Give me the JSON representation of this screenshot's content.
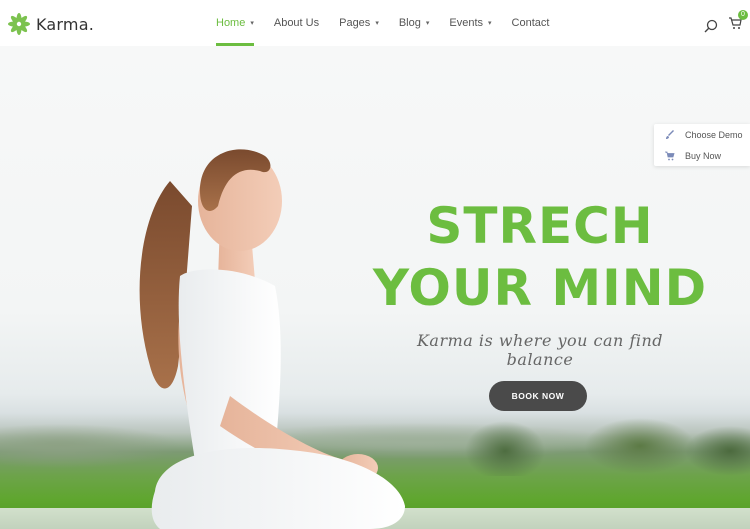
{
  "brand": {
    "name": "Karma.",
    "accent": "#6cbd40",
    "dark": "#4a4a4a"
  },
  "nav": {
    "items": [
      {
        "label": "Home",
        "has_dropdown": true,
        "active": true
      },
      {
        "label": "About Us",
        "has_dropdown": false,
        "active": false
      },
      {
        "label": "Pages",
        "has_dropdown": true,
        "active": false
      },
      {
        "label": "Blog",
        "has_dropdown": true,
        "active": false
      },
      {
        "label": "Events",
        "has_dropdown": true,
        "active": false
      },
      {
        "label": "Contact",
        "has_dropdown": false,
        "active": false
      }
    ],
    "caret": "▾"
  },
  "header_icons": {
    "search": "search-icon",
    "cart": "cart-icon",
    "cart_count": "0"
  },
  "side_panel": {
    "items": [
      {
        "label": "Choose Demo",
        "icon": "brush-icon",
        "glyph": "🖌"
      },
      {
        "label": "Buy Now",
        "icon": "cart-icon",
        "glyph": "🛒"
      }
    ]
  },
  "hero": {
    "title_line1": "STRECH",
    "title_line2": "YOUR MIND",
    "subtitle": "Karma is where you can find balance",
    "button": "BOOK NOW"
  }
}
